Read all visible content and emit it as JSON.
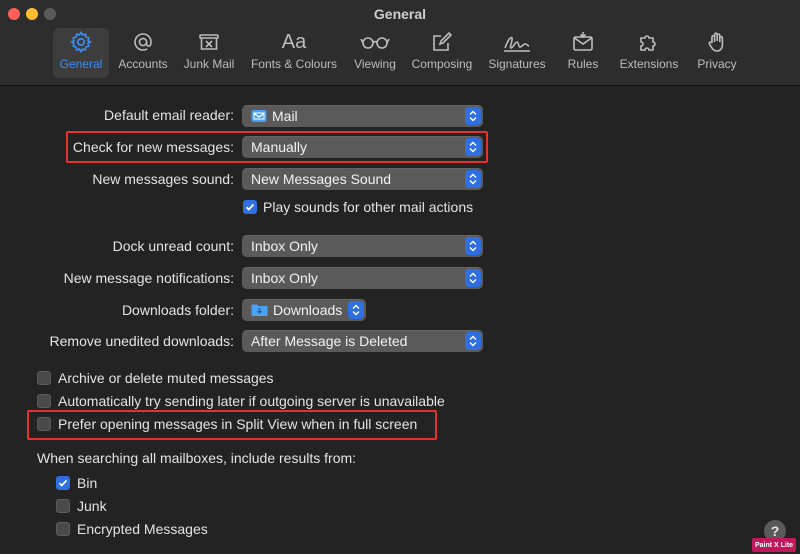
{
  "window": {
    "title": "General"
  },
  "toolbar": [
    {
      "id": "general",
      "label": "General",
      "icon": "gear-icon",
      "active": true
    },
    {
      "id": "accounts",
      "label": "Accounts",
      "icon": "at-icon",
      "active": false
    },
    {
      "id": "junk",
      "label": "Junk Mail",
      "icon": "junk-mail-icon",
      "active": false
    },
    {
      "id": "fonts",
      "label": "Fonts & Colours",
      "icon": "fonts-icon",
      "active": false
    },
    {
      "id": "viewing",
      "label": "Viewing",
      "icon": "glasses-icon",
      "active": false
    },
    {
      "id": "composing",
      "label": "Composing",
      "icon": "compose-icon",
      "active": false
    },
    {
      "id": "signatures",
      "label": "Signatures",
      "icon": "signature-icon",
      "active": false
    },
    {
      "id": "rules",
      "label": "Rules",
      "icon": "rules-envelope-icon",
      "active": false
    },
    {
      "id": "extensions",
      "label": "Extensions",
      "icon": "puzzle-icon",
      "active": false
    },
    {
      "id": "privacy",
      "label": "Privacy",
      "icon": "hand-icon",
      "active": false
    }
  ],
  "fonts_glyph": "Aa",
  "settings": {
    "default_reader": {
      "label": "Default email reader:",
      "value": "Mail",
      "icon": "mail-app-icon"
    },
    "check_new": {
      "label": "Check for new messages:",
      "value": "Manually"
    },
    "sound": {
      "label": "New messages sound:",
      "value": "New Messages Sound"
    },
    "play_sounds": {
      "label": "Play sounds for other mail actions",
      "checked": true
    },
    "dock_count": {
      "label": "Dock unread count:",
      "value": "Inbox Only"
    },
    "notifications": {
      "label": "New message notifications:",
      "value": "Inbox Only"
    },
    "downloads": {
      "label": "Downloads folder:",
      "value": "Downloads",
      "icon": "downloads-folder-icon"
    },
    "remove_downloads": {
      "label": "Remove unedited downloads:",
      "value": "After Message is Deleted"
    }
  },
  "options": [
    {
      "label": "Archive or delete muted messages",
      "checked": false
    },
    {
      "label": "Automatically try sending later if outgoing server is unavailable",
      "checked": false
    },
    {
      "label": "Prefer opening messages in Split View when in full screen",
      "checked": false
    }
  ],
  "search": {
    "heading": "When searching all mailboxes, include results from:",
    "items": [
      {
        "label": "Bin",
        "checked": true
      },
      {
        "label": "Junk",
        "checked": false
      },
      {
        "label": "Encrypted Messages",
        "checked": false
      }
    ]
  },
  "help_symbol": "?",
  "watermark": "Paint X Lite",
  "colors": {
    "accent": "#2f6fe0",
    "highlight": "#e5322d",
    "background": "#232323"
  }
}
